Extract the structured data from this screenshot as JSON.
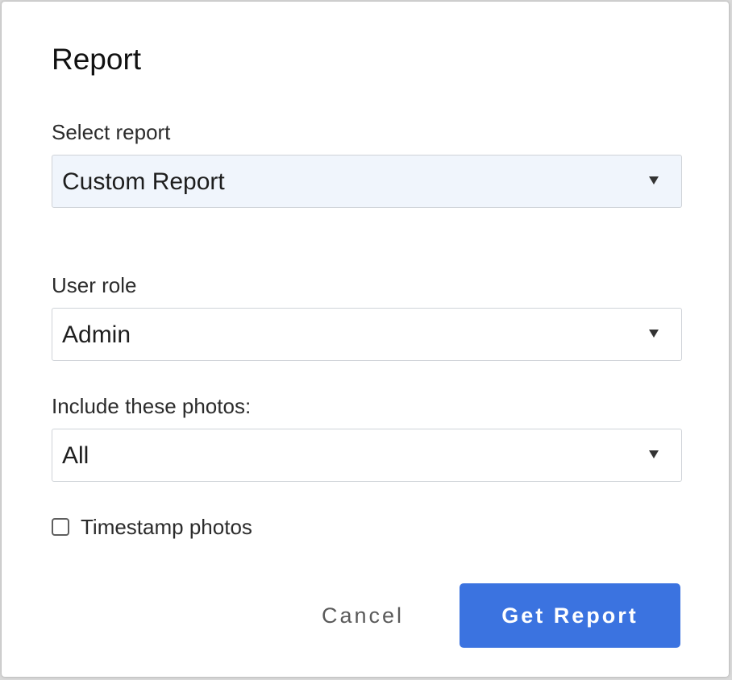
{
  "dialog": {
    "title": "Report"
  },
  "fields": {
    "report": {
      "label": "Select report",
      "value": "Custom Report"
    },
    "role": {
      "label": "User role",
      "value": "Admin"
    },
    "photos": {
      "label": "Include these photos:",
      "value": "All"
    }
  },
  "timestamp": {
    "label": "Timestamp photos",
    "checked": false
  },
  "actions": {
    "cancel_label": "Cancel",
    "submit_label": "Get Report"
  },
  "colors": {
    "primary": "#3b73e0",
    "select_highlight": "#f0f5fc"
  },
  "icons": {
    "select_caret": "caret-down-icon"
  }
}
